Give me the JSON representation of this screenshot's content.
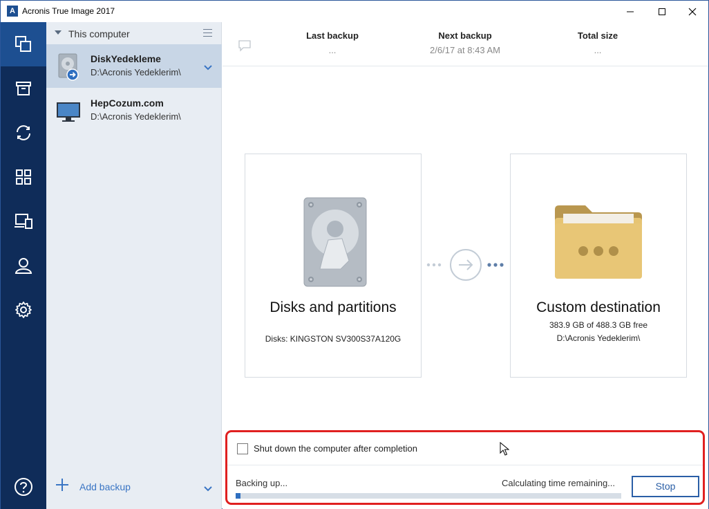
{
  "window": {
    "title": "Acronis True Image 2017",
    "logo_letter": "A"
  },
  "nav": {
    "items": [
      {
        "name": "backup",
        "icon": "backup-copies-icon",
        "active": true
      },
      {
        "name": "archive",
        "icon": "archive-box-icon",
        "active": false
      },
      {
        "name": "sync",
        "icon": "sync-icon",
        "active": false
      },
      {
        "name": "dashboard",
        "icon": "dashboard-grid-icon",
        "active": false
      },
      {
        "name": "tools",
        "icon": "devices-icon",
        "active": false
      },
      {
        "name": "account",
        "icon": "user-icon",
        "active": false
      },
      {
        "name": "settings",
        "icon": "gear-icon",
        "active": false
      }
    ],
    "help_icon": "help-icon"
  },
  "list": {
    "header": "This computer",
    "items": [
      {
        "name": "DiskYedekleme",
        "path": "D:\\Acronis Yedeklerim\\",
        "selected": true
      },
      {
        "name": "HepCozum.com",
        "path": "D:\\Acronis Yedeklerim\\",
        "selected": false
      }
    ],
    "add_label": "Add backup"
  },
  "summary": {
    "last_backup_label": "Last backup",
    "last_backup_value": "...",
    "next_backup_label": "Next backup",
    "next_backup_value": "2/6/17 at 8:43 AM",
    "total_size_label": "Total size",
    "total_size_value": "..."
  },
  "source": {
    "title": "Disks and partitions",
    "detail": "Disks: KINGSTON SV300S37A120G"
  },
  "destination": {
    "title": "Custom destination",
    "free": "383.9 GB of 488.3 GB free",
    "path": "D:\\Acronis Yedeklerim\\"
  },
  "bottom": {
    "shutdown_label": "Shut down the computer after completion",
    "shutdown_checked": false,
    "status_left": "Backing up...",
    "status_right": "Calculating time remaining...",
    "progress_fraction": 0.013,
    "stop_label": "Stop"
  },
  "colors": {
    "accent": "#2f6fc0",
    "nav_bg": "#0f2c59",
    "nav_active": "#1d4f91",
    "highlight": "#e02020"
  }
}
